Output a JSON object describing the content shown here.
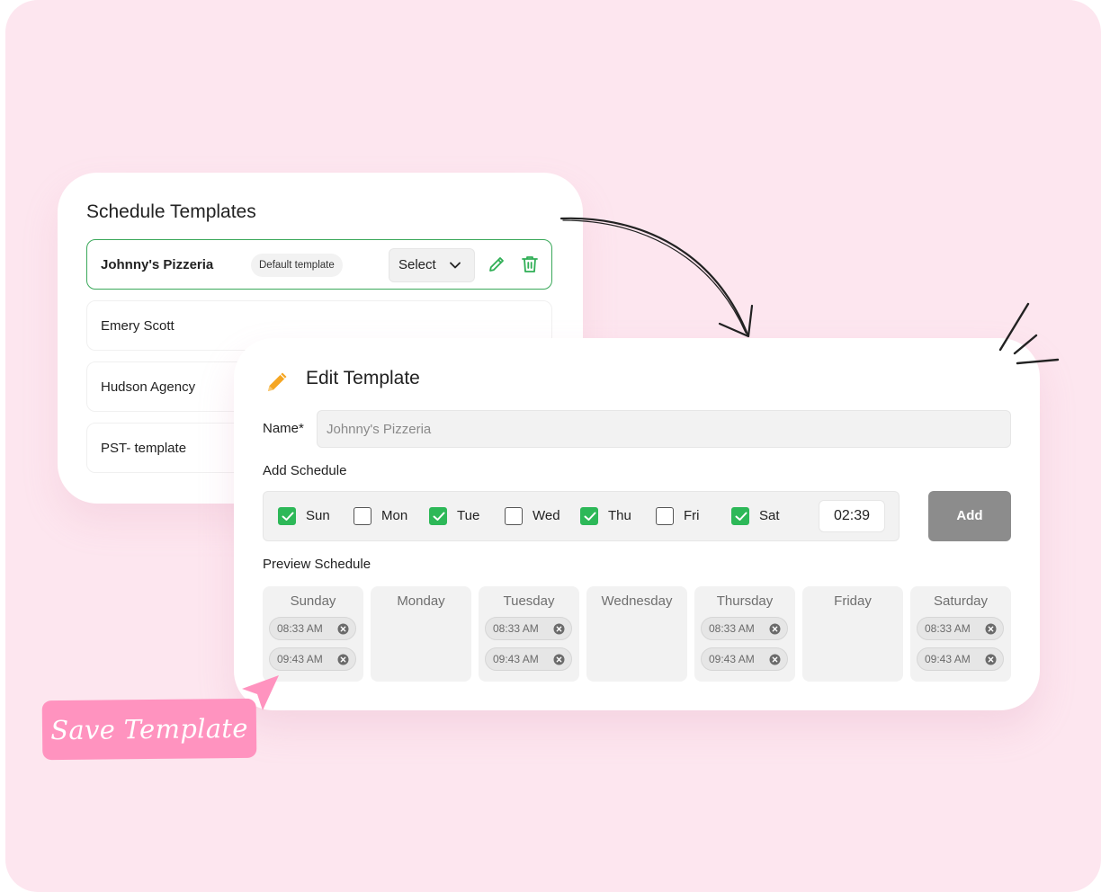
{
  "colors": {
    "background": "#fde6ef",
    "accent_green": "#2db858",
    "save_pink": "#ff93bf",
    "pencil_orange": "#f5a623"
  },
  "templates_panel": {
    "title": "Schedule Templates",
    "items": [
      {
        "name": "Johnny's Pizzeria",
        "badge": "Default template",
        "select_label": "Select",
        "active": true
      },
      {
        "name": "Emery Scott"
      },
      {
        "name": "Hudson Agency"
      },
      {
        "name": "PST- template"
      }
    ]
  },
  "edit_template": {
    "title": "Edit Template",
    "name_label": "Name*",
    "name_value": "Johnny's Pizzeria",
    "add_schedule_label": "Add Schedule",
    "days": [
      {
        "label": "Sun",
        "checked": true
      },
      {
        "label": "Mon",
        "checked": false
      },
      {
        "label": "Tue",
        "checked": true
      },
      {
        "label": "Wed",
        "checked": false
      },
      {
        "label": "Thu",
        "checked": true
      },
      {
        "label": "Fri",
        "checked": false
      },
      {
        "label": "Sat",
        "checked": true
      }
    ],
    "time_value": "02:39",
    "add_button": "Add",
    "preview_label": "Preview Schedule",
    "preview": [
      {
        "day": "Sunday",
        "times": [
          "08:33 AM",
          "09:43 AM"
        ]
      },
      {
        "day": "Monday",
        "times": []
      },
      {
        "day": "Tuesday",
        "times": [
          "08:33 AM",
          "09:43 AM"
        ]
      },
      {
        "day": "Wednesday",
        "times": []
      },
      {
        "day": "Thursday",
        "times": [
          "08:33 AM",
          "09:43 AM"
        ]
      },
      {
        "day": "Friday",
        "times": []
      },
      {
        "day": "Saturday",
        "times": [
          "08:33 AM",
          "09:43 AM"
        ]
      }
    ]
  },
  "save_template_label": "Save Template",
  "icons": [
    "pencil-icon",
    "trash-icon",
    "chevron-down-icon",
    "check-icon",
    "close-circle-icon",
    "cursor-icon",
    "arrow-doodle",
    "sparkle-doodle"
  ]
}
